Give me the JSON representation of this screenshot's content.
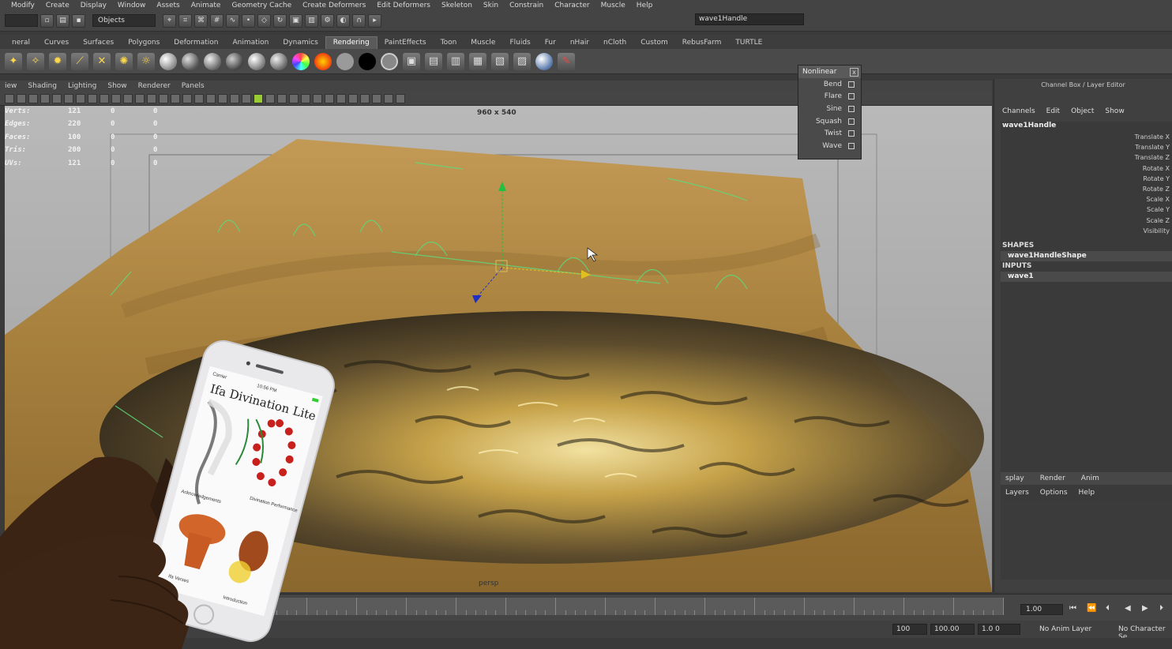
{
  "menubar": {
    "items": [
      "Modify",
      "Create",
      "Display",
      "Window",
      "Assets",
      "Animate",
      "Geometry Cache",
      "Create Deformers",
      "Edit Deformers",
      "Skeleton",
      "Skin",
      "Constrain",
      "Character",
      "Muscle",
      "Help"
    ]
  },
  "status_line": {
    "objects_field": "Objects",
    "name_field": "wave1Handle"
  },
  "shelf_tabs": {
    "items": [
      "neral",
      "Curves",
      "Surfaces",
      "Polygons",
      "Deformation",
      "Animation",
      "Dynamics",
      "Rendering",
      "PaintEffects",
      "Toon",
      "Muscle",
      "Fluids",
      "Fur",
      "nHair",
      "nCloth",
      "Custom",
      "RebusFarm",
      "TURTLE"
    ],
    "active": "Rendering"
  },
  "viewport": {
    "menu": [
      "iew",
      "Shading",
      "Lighting",
      "Show",
      "Renderer",
      "Panels"
    ],
    "hud": {
      "rows": [
        {
          "label": "Verts:",
          "v0": "121",
          "v1": "0",
          "v2": "0"
        },
        {
          "label": "Edges:",
          "v0": "220",
          "v1": "0",
          "v2": "0"
        },
        {
          "label": "Faces:",
          "v0": "100",
          "v1": "0",
          "v2": "0"
        },
        {
          "label": "Tris:",
          "v0": "200",
          "v1": "0",
          "v2": "0"
        },
        {
          "label": "UVs:",
          "v0": "121",
          "v1": "0",
          "v2": "0"
        }
      ]
    },
    "resolution_gate": "960 x 540",
    "camera_label": "persp"
  },
  "nonlinear_menu": {
    "title": "Nonlinear",
    "close": "x",
    "items": [
      "Bend",
      "Flare",
      "Sine",
      "Squash",
      "Twist",
      "Wave"
    ]
  },
  "channel_box": {
    "title": "Channel Box / Layer Editor",
    "menu": [
      "Channels",
      "Edit",
      "Object",
      "Show"
    ],
    "node": "wave1Handle",
    "attributes": [
      "Translate X",
      "Translate Y",
      "Translate Z",
      "Rotate X",
      "Rotate Y",
      "Rotate Z",
      "Scale X",
      "Scale Y",
      "Scale Z",
      "Visibility"
    ],
    "shapes_header": "SHAPES",
    "shape_node": "wave1HandleShape",
    "inputs_header": "INPUTS",
    "input_node": "wave1"
  },
  "layer_editor": {
    "tabs": [
      "splay",
      "Render",
      "Anim"
    ],
    "menu": [
      "Layers",
      "Options",
      "Help"
    ]
  },
  "time_slider": {
    "current_frame": "1.00",
    "start_field": "1.0",
    "range_end": "100",
    "end_time": "100.00",
    "range_field": "1.0 0",
    "anim_layer": "No Anim Layer",
    "character": "No Character Se"
  },
  "phone": {
    "carrier": "Carrier",
    "time": "10:56 PM",
    "app_title": "Ifa Divination Lite",
    "labels": [
      "Acknowledgements",
      "Divination Performance",
      "Ifa Verses",
      "Introduction"
    ]
  },
  "colors": {
    "ui_bg": "#444444",
    "sand": "#b0894a",
    "water_gold": "#d9b85a",
    "active_tab": "#5a5a5a"
  }
}
